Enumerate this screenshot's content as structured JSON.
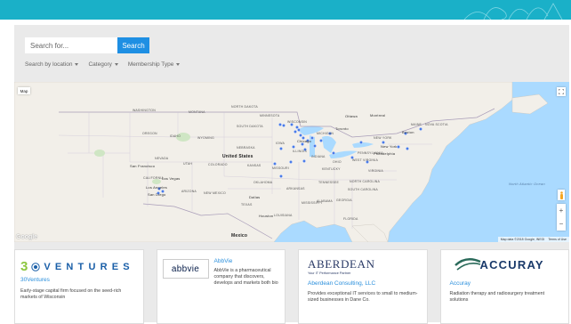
{
  "search": {
    "placeholder": "Search for...",
    "button_label": "Search"
  },
  "filters": [
    {
      "label": "Search by location"
    },
    {
      "label": "Category"
    },
    {
      "label": "Membership Type"
    }
  ],
  "map": {
    "type_button": "Map",
    "labels": {
      "washington": "WASHINGTON",
      "montana": "MONTANA",
      "north_dakota": "NORTH DAKOTA",
      "minnesota": "MINNESOTA",
      "oregon": "OREGON",
      "idaho": "IDAHO",
      "south_dakota": "SOUTH DAKOTA",
      "wyoming": "WYOMING",
      "wisconsin": "WISCONSIN",
      "michigan": "MICHIGAN",
      "nebraska": "NEBRASKA",
      "iowa": "IOWA",
      "nevada": "NEVADA",
      "utah": "UTAH",
      "colorado": "COLORADO",
      "kansas": "KANSAS",
      "missouri": "MISSOURI",
      "illinois": "ILLINOIS",
      "california": "CALIFORNIA",
      "arizona": "ARIZONA",
      "new_mexico": "NEW MEXICO",
      "oklahoma": "OKLAHOMA",
      "arkansas": "ARKANSAS",
      "tennessee": "TENNESSEE",
      "north_carolina": "NORTH CAROLINA",
      "texas": "TEXAS",
      "louisiana": "LOUISIANA",
      "georgia": "GEORGIA",
      "south_carolina": "SOUTH CAROLINA",
      "alabama": "ALABAMA",
      "west_virginia": "WEST VIRGINIA",
      "virginia": "VIRGINIA",
      "pennsylvania": "PENNSYLVANIA",
      "new_york": "NEW YORK",
      "maine": "MAINE",
      "nova_scotia": "NOVA SCOTIA",
      "ohio": "OHIO",
      "indiana": "INDIANA",
      "kentucky": "KENTUCKY",
      "mississippi": "MISSISSIPPI",
      "florida": "FLORIDA",
      "united_states": "United States",
      "mexico": "Mexico",
      "ottawa": "Ottawa",
      "montreal": "Montreal",
      "toronto": "Toronto",
      "boston": "Boston",
      "new_york_city": "New York",
      "philadelphia": "Philadelphia",
      "chicago": "Chicago",
      "san_francisco": "San Francisco",
      "las_vegas": "Las Vegas",
      "los_angeles": "Los Angeles",
      "san_diego": "San Diego",
      "dallas": "Dallas",
      "houston": "Houston",
      "north_atlantic_ocean": "North Atlantic Ocean"
    },
    "google_logo": "Google",
    "attribution": "Map data ©2018 Google, INEGI",
    "terms": "Terms of Use",
    "zoom_in": "+",
    "zoom_out": "−",
    "colors": {
      "water": "#aadaff",
      "land": "#f2efe9",
      "marker": "#4a7be8",
      "park": "#cfe6c4"
    }
  },
  "cards": [
    {
      "logo_text": "VENTURES",
      "logo_prefix": "3",
      "name": "30Ventures",
      "description": "Early-stage capital firm focused on the seed-rich markets of Wisconsin"
    },
    {
      "logo_text": "abbvie",
      "name": "AbbVie",
      "description": "AbbVie is a pharmaceutical company that discovers, develops and markets both bio"
    },
    {
      "logo_text": "ABERDEAN",
      "logo_tagline": "Your IT Performance Partner",
      "name": "Aberdean Consulting, LLC",
      "description": "Provides exceptional IT services to small to medium-sized businesses in Dane Co."
    },
    {
      "logo_text": "ACCURAY",
      "name": "Accuray",
      "description": "Radiation therapy and radiosurgery treatment solutions"
    }
  ]
}
